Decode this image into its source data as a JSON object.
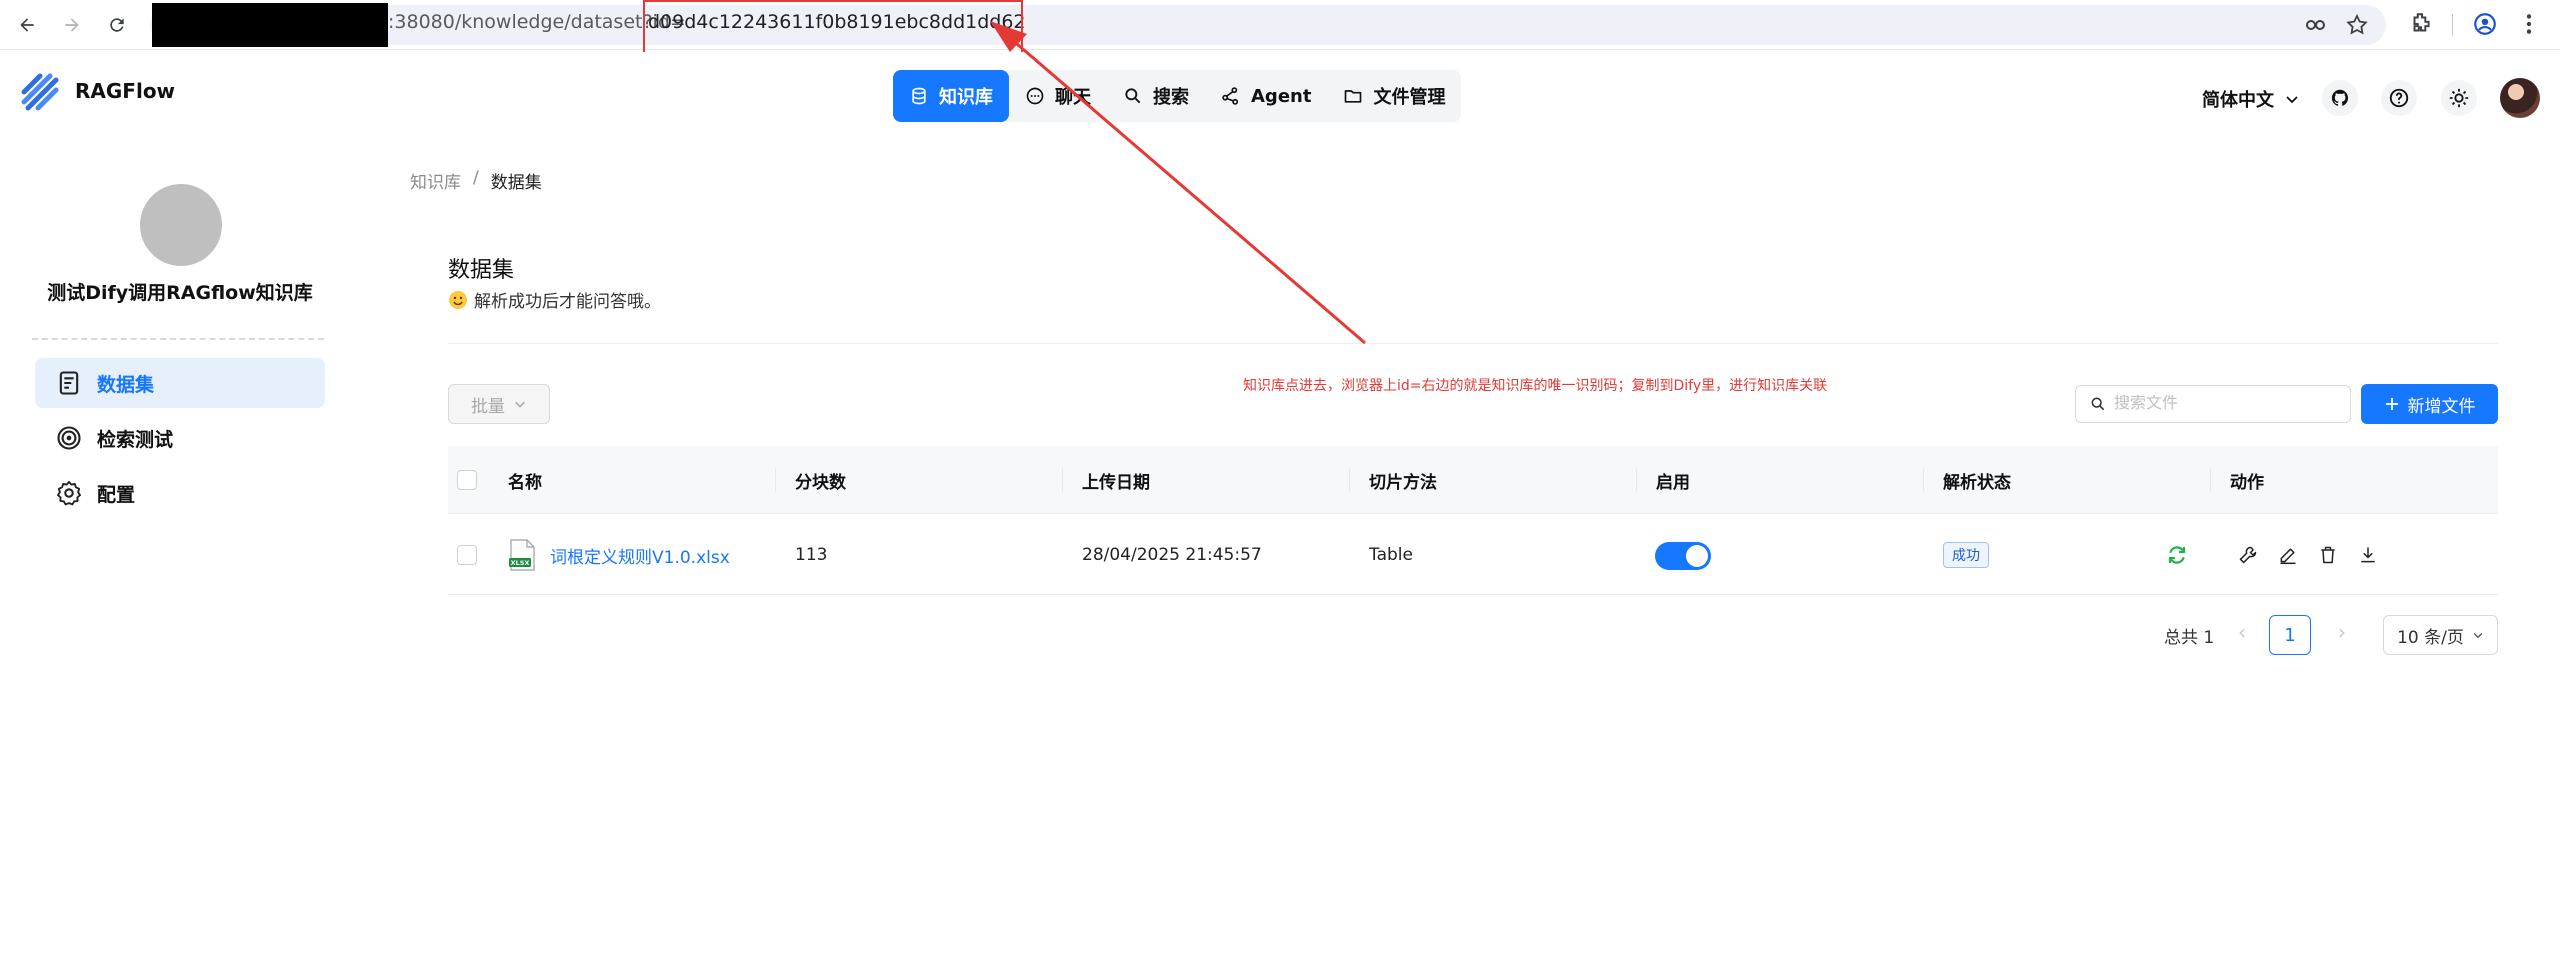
{
  "browser": {
    "url_host": ":38080/knowledge/dataset?id=",
    "url_id": "d09d4c12243611f0b8191ebc8dd1dd62",
    "icons": [
      "back-icon",
      "forward-icon",
      "reload-icon",
      "password-key-icon",
      "star-icon",
      "extensions-icon",
      "profile-icon",
      "menu-icon"
    ]
  },
  "header": {
    "brand": "RAGFlow",
    "nav": [
      {
        "label": "知识库",
        "icon": "database-icon",
        "active": true
      },
      {
        "label": "聊天",
        "icon": "chat-icon",
        "active": false
      },
      {
        "label": "搜索",
        "icon": "search-icon",
        "active": false
      },
      {
        "label": "Agent",
        "icon": "agent-icon",
        "active": false
      },
      {
        "label": "文件管理",
        "icon": "folder-icon",
        "active": false
      }
    ],
    "language": "简体中文"
  },
  "sidebar": {
    "kb_name": "测试Dify调用RAGflow知识库",
    "items": [
      {
        "label": "数据集",
        "icon": "document-icon",
        "active": true
      },
      {
        "label": "检索测试",
        "icon": "target-icon",
        "active": false
      },
      {
        "label": "配置",
        "icon": "gear-icon",
        "active": false
      }
    ]
  },
  "main": {
    "breadcrumb": [
      "知识库",
      "数据集"
    ],
    "title": "数据集",
    "description": "解析成功后才能问答哦。",
    "annotation": "知识库点进去，浏览器上id=右边的就是知识库的唯一识别码；复制到Dify里，进行知识库关联",
    "bulk_label": "批量",
    "search_placeholder": "搜索文件",
    "add_label": "新增文件",
    "columns": [
      "名称",
      "分块数",
      "上传日期",
      "切片方法",
      "启用",
      "解析状态",
      "动作"
    ],
    "rows": [
      {
        "name": "词根定义规则V1.0.xlsx",
        "chunks": "113",
        "upload_date": "28/04/2025 21:45:57",
        "method": "Table",
        "enabled": true,
        "status": "成功",
        "file_badge": "XLSX"
      }
    ],
    "pagination": {
      "total": "总共 1",
      "page": "1",
      "page_size": "10 条/页"
    }
  },
  "colors": {
    "accent": "#1677ff",
    "annotation": "#e53935",
    "success": "#22b24c"
  }
}
